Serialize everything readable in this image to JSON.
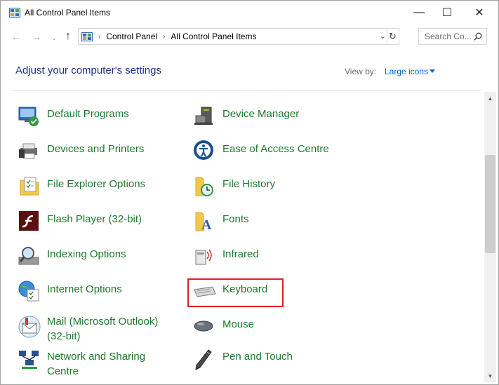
{
  "window": {
    "title": "All Control Panel Items",
    "controls": {
      "minimize": "—",
      "maximize": "☐",
      "close": "✕"
    }
  },
  "nav": {
    "back": "←",
    "forward": "→",
    "recent": "⌄",
    "up": "↑"
  },
  "address": {
    "sep": "›",
    "crumbs": [
      "Control Panel",
      "All Control Panel Items"
    ],
    "dropdown": "⌄",
    "refresh": "↻"
  },
  "search": {
    "placeholder": "Search Co..."
  },
  "header": {
    "title": "Adjust your computer's settings",
    "view_by_label": "View by:",
    "view_by_value": "Large icons"
  },
  "items_left": [
    {
      "label": "Default Programs",
      "icon": "default-programs-icon"
    },
    {
      "label": "Devices and Printers",
      "icon": "devices-printers-icon"
    },
    {
      "label": "File Explorer Options",
      "icon": "file-explorer-options-icon"
    },
    {
      "label": "Flash Player (32-bit)",
      "icon": "flash-player-icon"
    },
    {
      "label": "Indexing Options",
      "icon": "indexing-options-icon"
    },
    {
      "label": "Internet Options",
      "icon": "internet-options-icon"
    },
    {
      "label": "Mail (Microsoft Outlook) (32-bit)",
      "icon": "mail-icon"
    },
    {
      "label": "Network and Sharing Centre",
      "icon": "network-sharing-icon"
    }
  ],
  "items_right": [
    {
      "label": "Device Manager",
      "icon": "device-manager-icon"
    },
    {
      "label": "Ease of Access Centre",
      "icon": "ease-of-access-icon"
    },
    {
      "label": "File History",
      "icon": "file-history-icon"
    },
    {
      "label": "Fonts",
      "icon": "fonts-icon"
    },
    {
      "label": "Infrared",
      "icon": "infrared-icon"
    },
    {
      "label": "Keyboard",
      "icon": "keyboard-icon"
    },
    {
      "label": "Mouse",
      "icon": "mouse-icon"
    },
    {
      "label": "Pen and Touch",
      "icon": "pen-touch-icon"
    }
  ],
  "scrollbar": {
    "up": "▲",
    "down": "▼"
  },
  "colors": {
    "link_green": "#1d7a2c",
    "heading_blue": "#1e3287",
    "highlight_red": "#e02020"
  }
}
